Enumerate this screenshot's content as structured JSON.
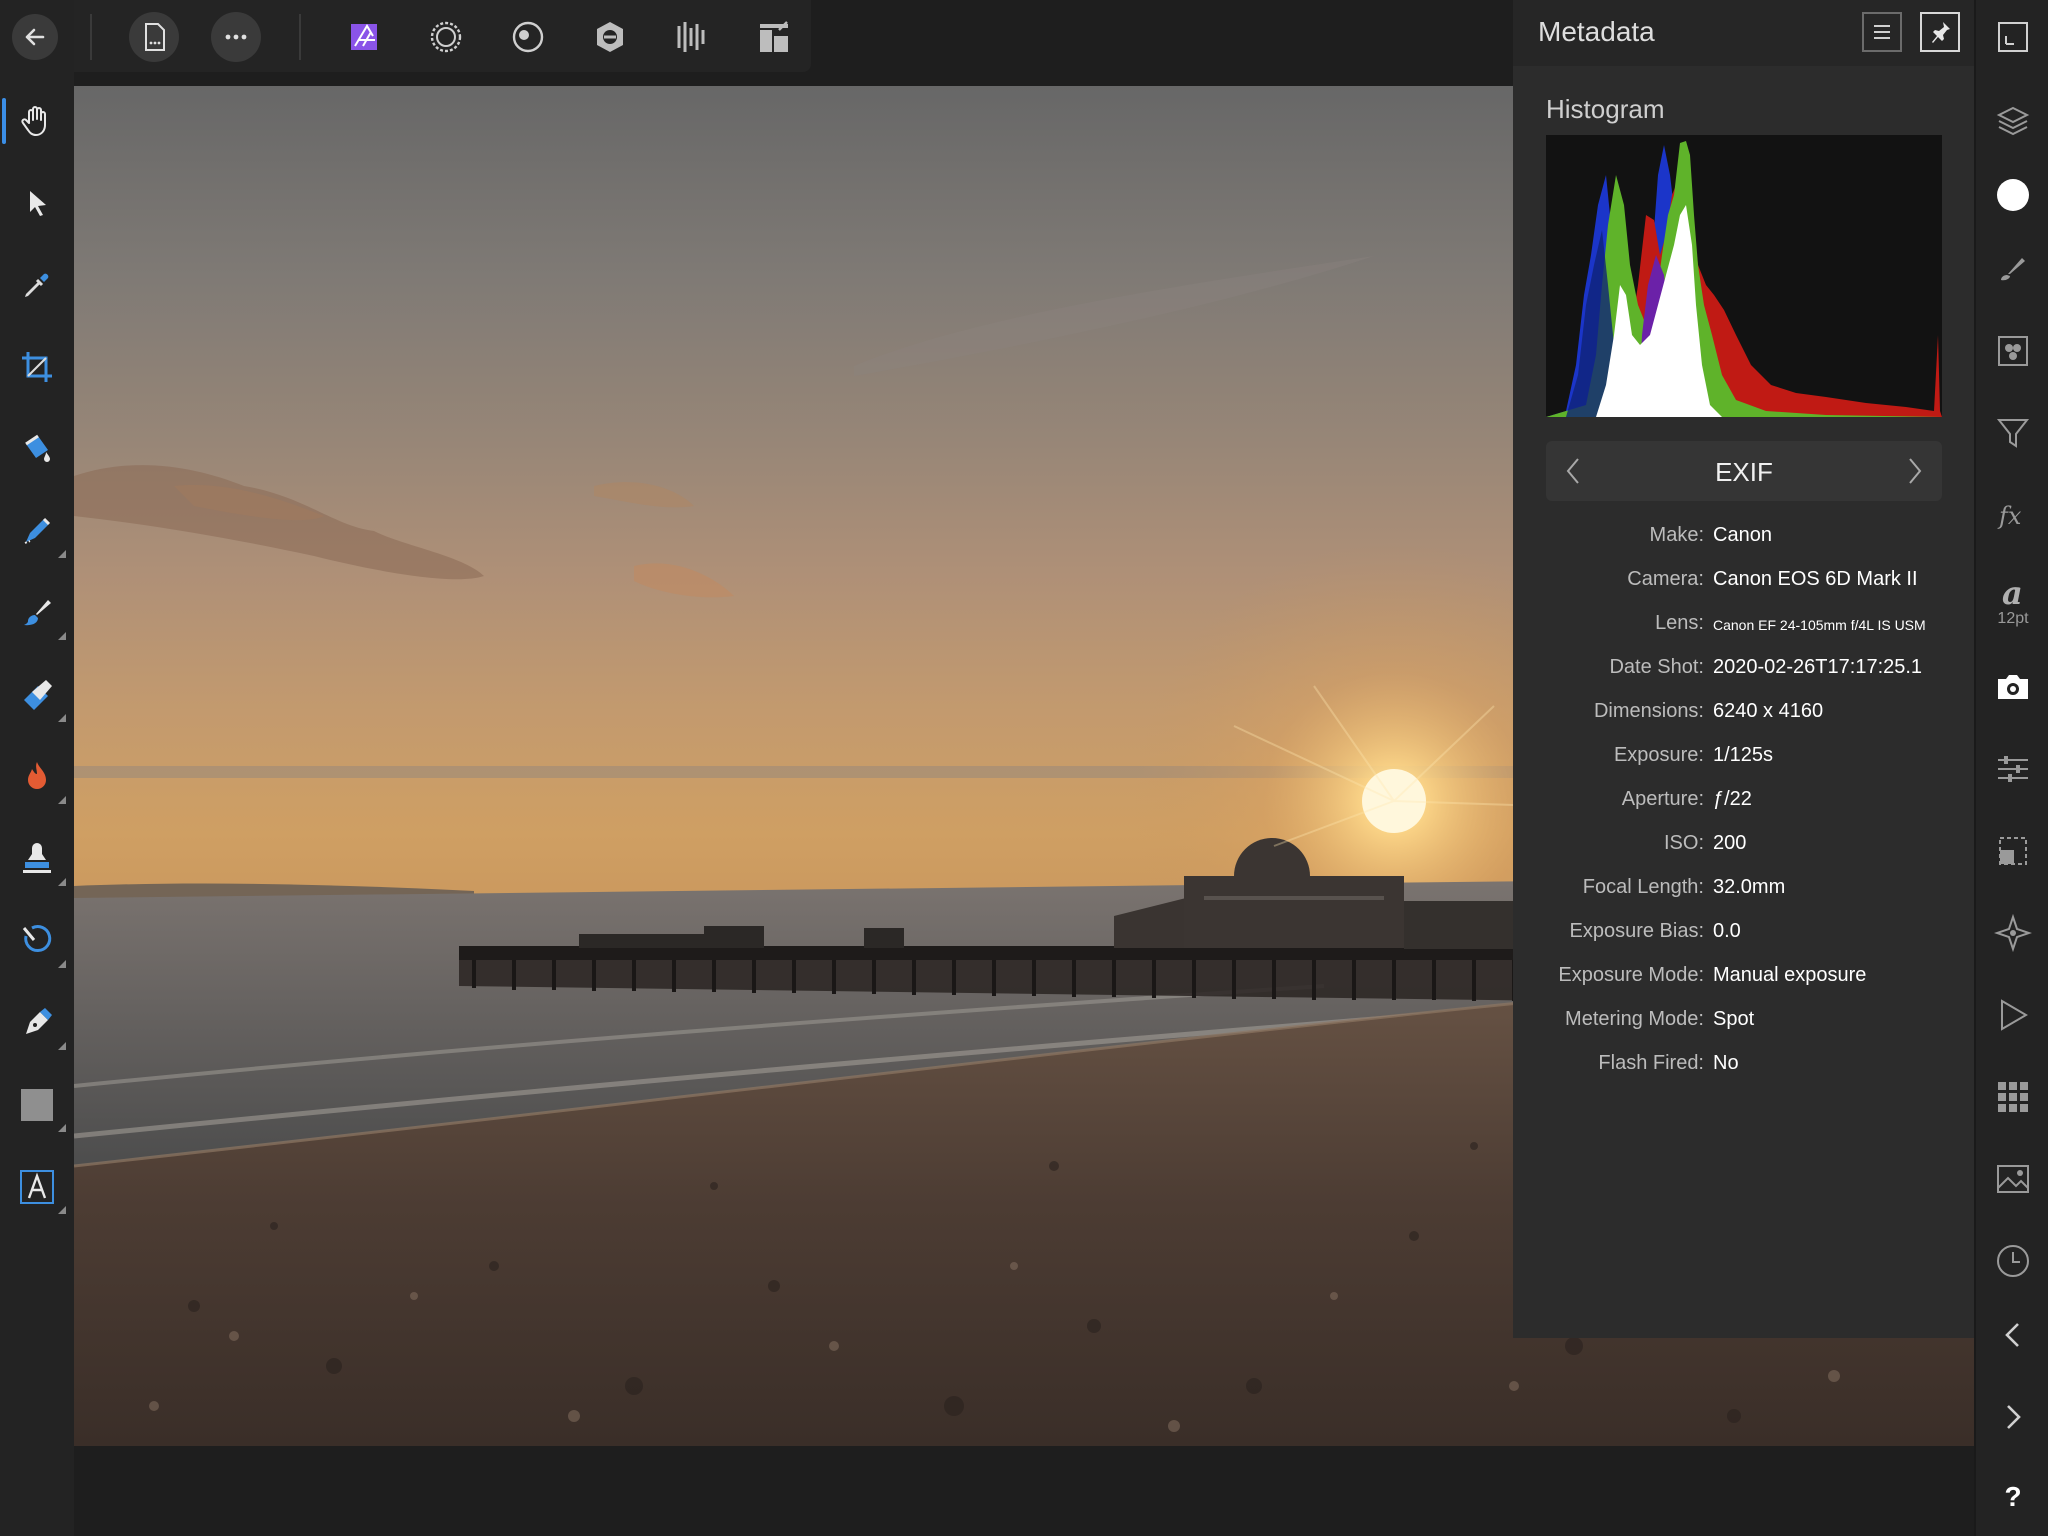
{
  "top_toolbar": {
    "buttons": [
      {
        "name": "document-menu-icon"
      },
      {
        "name": "more-options-icon"
      },
      {
        "name": "photo-persona-icon",
        "accent": "#8a54e8"
      },
      {
        "name": "liquify-persona-icon"
      },
      {
        "name": "develop-persona-icon"
      },
      {
        "name": "tone-mapping-persona-icon"
      },
      {
        "name": "export-persona-icon"
      },
      {
        "name": "arrange-icon"
      }
    ]
  },
  "left_toolbar": {
    "selected_tool": "view-tool",
    "tools": [
      "view-tool",
      "move-tool",
      "color-picker-tool",
      "crop-tool",
      "flood-fill-tool",
      "selection-brush-tool",
      "paint-brush-tool",
      "erase-brush-tool",
      "dodge-burn-tool",
      "clone-tool",
      "redeye-tool",
      "pen-tool",
      "rectangle-tool",
      "text-tool"
    ]
  },
  "metadata_panel": {
    "title": "Metadata",
    "histogram_title": "Histogram",
    "section": "EXIF",
    "rows": [
      {
        "key": "Make:",
        "value": "Canon"
      },
      {
        "key": "Camera:",
        "value": "Canon EOS 6D Mark II"
      },
      {
        "key": "Lens:",
        "value": "Canon EF 24-105mm f/4L IS USM"
      },
      {
        "key": "Date Shot:",
        "value": "2020-02-26T17:17:25.1"
      },
      {
        "key": "Dimensions:",
        "value": "6240 x 4160"
      },
      {
        "key": "Exposure:",
        "value": "1/125s"
      },
      {
        "key": "Aperture:",
        "value": "ƒ/22"
      },
      {
        "key": "ISO:",
        "value": "200"
      },
      {
        "key": "Focal Length:",
        "value": "32.0mm"
      },
      {
        "key": "Exposure Bias:",
        "value": "0.0"
      },
      {
        "key": "Exposure Mode:",
        "value": "Manual exposure"
      },
      {
        "key": "Metering Mode:",
        "value": "Spot"
      },
      {
        "key": "Flash Fired:",
        "value": "No"
      }
    ]
  },
  "right_toolbar": {
    "character_size": "12pt",
    "help": "?"
  },
  "colors": {
    "accent": "#3b8ee6",
    "persona_accent": "#8a54e8",
    "histogram_red": "#c01a14",
    "histogram_green": "#5fb32a",
    "histogram_blue": "#1b35c9",
    "histogram_white": "#ffffff"
  }
}
